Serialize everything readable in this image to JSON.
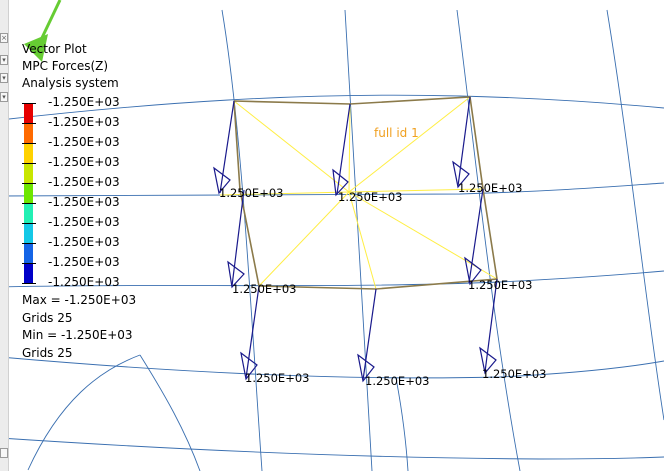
{
  "legend": {
    "title_lines": [
      "Vector Plot",
      "MPC Forces(Z)",
      "Analysis system"
    ],
    "levels": [
      {
        "label": "-1.250E+03",
        "color": "#e60000"
      },
      {
        "label": "-1.250E+03",
        "color": "#ff6a00"
      },
      {
        "label": "-1.250E+03",
        "color": "#ffd200"
      },
      {
        "label": "-1.250E+03",
        "color": "#c8e600"
      },
      {
        "label": "-1.250E+03",
        "color": "#6ee600"
      },
      {
        "label": "-1.250E+03",
        "color": "#22f0b4"
      },
      {
        "label": "-1.250E+03",
        "color": "#14c8e6"
      },
      {
        "label": "-1.250E+03",
        "color": "#1464e6"
      },
      {
        "label": "-1.250E+03",
        "color": "#0000c8"
      },
      {
        "label": "-1.250E+03"
      }
    ],
    "stats": [
      "Max = -1.250E+03",
      "Grids 25",
      "Min = -1.250E+03",
      "Grids 25"
    ]
  },
  "component_label": "full id 1",
  "vector_labels": [
    "1.250E+03",
    "1.250E+03",
    "1.250E+03",
    "1.250E+03",
    "1.250E+03",
    "1.250E+03",
    "1.250E+03",
    "1.250E+03",
    "1.250E+03"
  ],
  "colors": {
    "mesh_lines": "#3a6fb0",
    "element_edges": "#8b7a4a",
    "rbe_spider": "#ffee44",
    "vector_arrows": "#1a1a8c",
    "component_label": "#f0a020",
    "pointer_arrow": "#66cc33"
  }
}
